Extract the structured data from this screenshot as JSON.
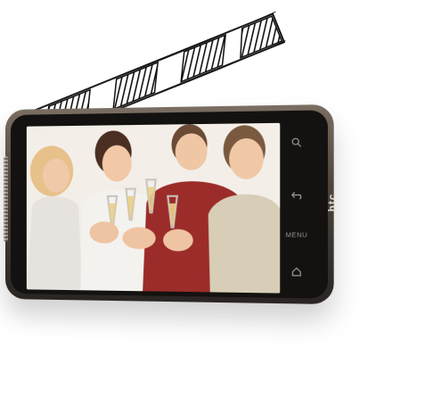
{
  "phone": {
    "brand_label": "htc",
    "menu_label": "MENU",
    "icons": [
      "search-icon",
      "back-icon",
      "home-icon"
    ]
  },
  "colors": {
    "background": "#ffffff",
    "phone_frame": "#6b6157",
    "bezel": "#141210",
    "screen_bg": "#efe9e1"
  }
}
